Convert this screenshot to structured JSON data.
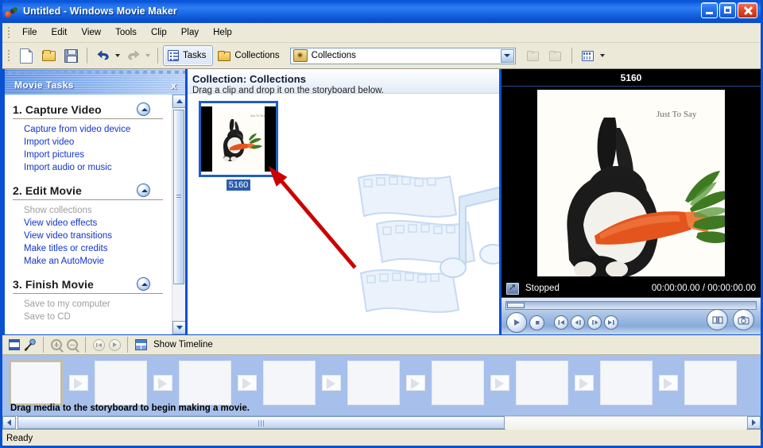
{
  "window": {
    "title_file": "Untitled",
    "title_sep": " - ",
    "title_app": "Windows Movie Maker",
    "icon": "film-reel-icon",
    "buttons": {
      "minimize": "minimize-button",
      "maximize": "maximize-button",
      "close": "close-button"
    }
  },
  "menubar": {
    "items": [
      "File",
      "Edit",
      "View",
      "Tools",
      "Clip",
      "Play",
      "Help"
    ]
  },
  "toolbar": {
    "new_label": "New Project",
    "open_label": "Open Project",
    "save_label": "Save Project",
    "undo_label": "Undo",
    "redo_label": "Redo",
    "tasks_label": "Tasks",
    "collections_label": "Collections",
    "combo_value": "Collections",
    "views_label": "Views"
  },
  "tasks_pane": {
    "title": "Movie Tasks",
    "close_label": "x",
    "groups": [
      {
        "number_title": "1. Capture Video",
        "links": [
          {
            "label": "Capture from video device",
            "disabled": false
          },
          {
            "label": "Import video",
            "disabled": false
          },
          {
            "label": "Import pictures",
            "disabled": false
          },
          {
            "label": "Import audio or music",
            "disabled": false
          }
        ]
      },
      {
        "number_title": "2. Edit Movie",
        "links": [
          {
            "label": "Show collections",
            "disabled": true
          },
          {
            "label": "View video effects",
            "disabled": false
          },
          {
            "label": "View video transitions",
            "disabled": false
          },
          {
            "label": "Make titles or credits",
            "disabled": false
          },
          {
            "label": "Make an AutoMovie",
            "disabled": false
          }
        ]
      },
      {
        "number_title": "3. Finish Movie",
        "links": [
          {
            "label": "Save to my computer",
            "disabled": true
          },
          {
            "label": "Save to CD",
            "disabled": true
          }
        ]
      }
    ]
  },
  "collection": {
    "title": "Collection: Collections",
    "subtitle": "Drag a clip and drop it on the storyboard below.",
    "clips": [
      {
        "name": "5160",
        "selected": true
      }
    ]
  },
  "preview": {
    "title": "5160",
    "image_caption": "Just To Say",
    "status": "Stopped",
    "time": "00:00:00.00 / 00:00:00.00",
    "controls": {
      "fullscreen": "fullscreen-icon",
      "play": "play-button",
      "stop": "stop-button",
      "prev_clip": "previous-frame-button",
      "back_frame": "step-back-button",
      "fwd_frame": "step-forward-button",
      "next_clip": "next-frame-button",
      "split": "split-clip-button",
      "capture": "take-picture-button"
    }
  },
  "storyboard_toolbar": {
    "storyboard_view_label": "Storyboard view",
    "narrate_label": "Narrate Timeline",
    "zoom_in_label": "Zoom In",
    "zoom_out_label": "Zoom Out",
    "rewind_label": "Rewind Timeline",
    "play_label": "Play Timeline",
    "show_timeline_label": "Show Timeline"
  },
  "storyboard": {
    "hint": "Drag media to the storyboard to begin making a movie.",
    "frame_count": 9,
    "selected_index": 0
  },
  "statusbar": {
    "text": "Ready"
  },
  "colors": {
    "title_blue": "#0a55d8",
    "border_blue": "#0a50d2",
    "chrome": "#ece9d8",
    "link_blue": "#1133cc",
    "storyboard_bg": "#a7c0eb",
    "arrow_red": "#cc0000",
    "selection_blue": "#2a5db0"
  }
}
